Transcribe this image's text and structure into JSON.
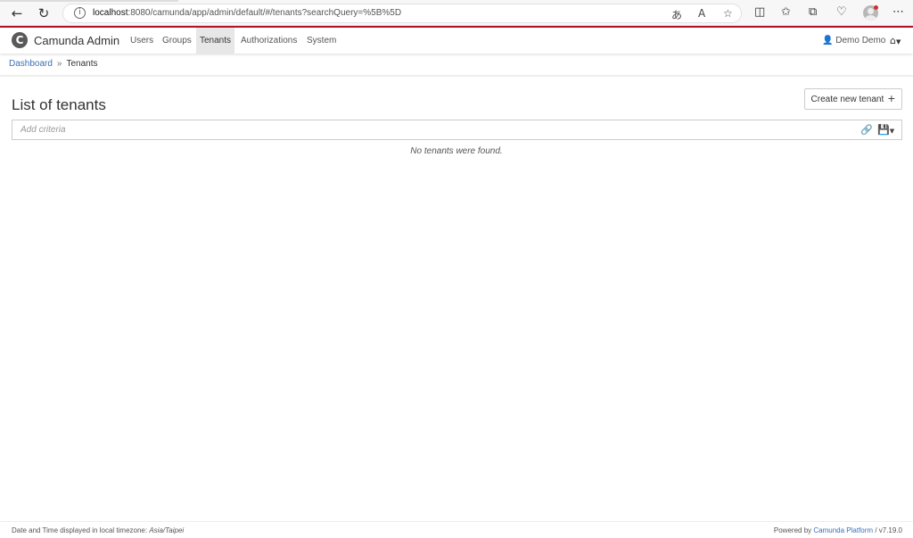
{
  "browser": {
    "url_host": "localhost",
    "url_rest": ":8080/camunda/app/admin/default/#/tenants?searchQuery=%5B%5D",
    "icons": [
      "back-icon",
      "refresh-icon",
      "info-icon",
      "translate-icon",
      "read-aloud-icon",
      "favorite-icon",
      "split-screen-icon",
      "favorites-icon",
      "collections-icon",
      "browser-essentials-icon",
      "profile-icon",
      "more-icon"
    ]
  },
  "header": {
    "brand": "Camunda Admin",
    "nav": [
      {
        "label": "Users"
      },
      {
        "label": "Groups"
      },
      {
        "label": "Tenants"
      },
      {
        "label": "Authorizations"
      },
      {
        "label": "System"
      }
    ],
    "active_nav": "Tenants",
    "user": "Demo Demo",
    "accent_color": "#b5152b"
  },
  "breadcrumb": {
    "dashboard": "Dashboard",
    "separator": "»",
    "current": "Tenants"
  },
  "main": {
    "title": "List of tenants",
    "create_button": "Create new tenant",
    "search_placeholder": "Add criteria",
    "empty_message": "No tenants were found."
  },
  "footer": {
    "timezone_label": "Date and Time displayed in local timezone:",
    "timezone": "Asia/Taipei",
    "powered_by": "Powered by",
    "platform": "Camunda Platform",
    "version": "/ v7.19.0"
  }
}
